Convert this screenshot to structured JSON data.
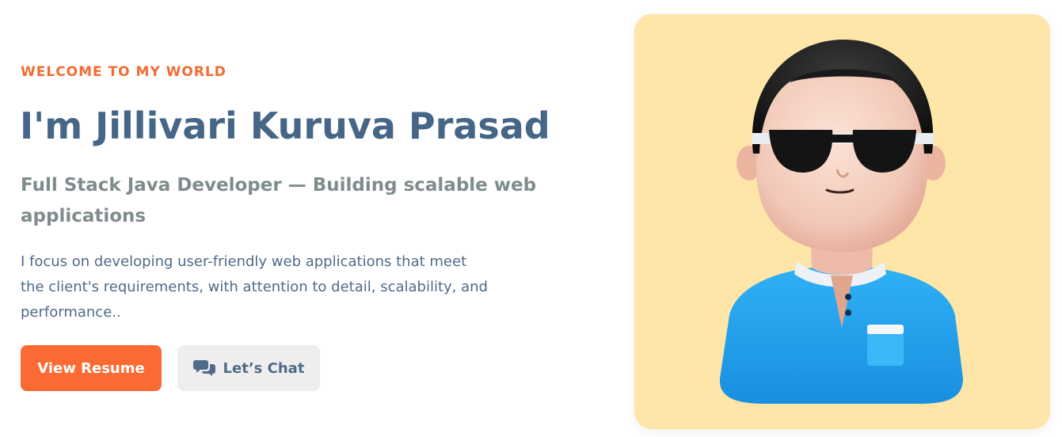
{
  "hero": {
    "eyebrow": "WELCOME TO MY WORLD",
    "title": "I'm Jillivari Kuruva Prasad",
    "subtitle": "Full Stack Java Developer — Building scalable web applications",
    "description": "I focus on developing user-friendly web applications that meet the client's requirements, with attention to detail, scalability, and performance.."
  },
  "buttons": {
    "resume_label": "View Resume",
    "chat_label": "Let’s Chat",
    "chat_icon": "comments-icon"
  },
  "colors": {
    "accent": "#fb6a33",
    "heading": "#456687",
    "subtitle": "#7f8c8d",
    "body_text": "#4f6b88",
    "avatar_background": "#fde6a8"
  }
}
